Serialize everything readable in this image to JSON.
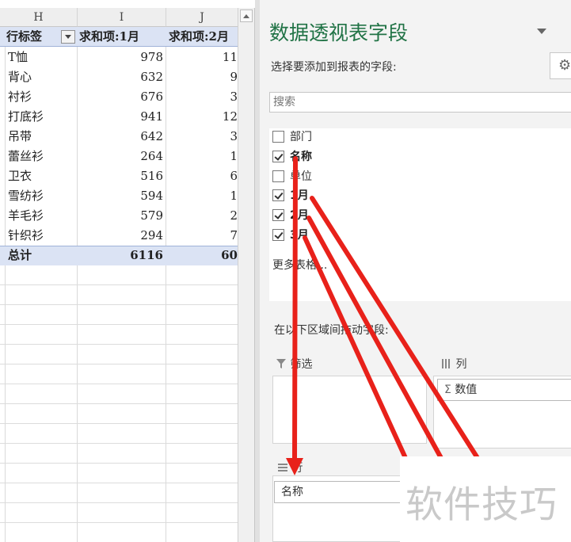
{
  "sheet": {
    "columns": [
      "H",
      "I",
      "J"
    ],
    "header": {
      "row_label": "行标签",
      "col1": "求和项:1月",
      "col2": "求和项:2月"
    },
    "rows": [
      {
        "label": "T恤",
        "v1": "978",
        "v2": "11"
      },
      {
        "label": "背心",
        "v1": "632",
        "v2": "9"
      },
      {
        "label": "衬衫",
        "v1": "676",
        "v2": "3"
      },
      {
        "label": "打底衫",
        "v1": "941",
        "v2": "12"
      },
      {
        "label": "吊带",
        "v1": "642",
        "v2": "3"
      },
      {
        "label": "蕾丝衫",
        "v1": "264",
        "v2": "1"
      },
      {
        "label": "卫衣",
        "v1": "516",
        "v2": "6"
      },
      {
        "label": "雪纺衫",
        "v1": "594",
        "v2": "1"
      },
      {
        "label": "羊毛衫",
        "v1": "579",
        "v2": "2"
      },
      {
        "label": "针织衫",
        "v1": "294",
        "v2": "7"
      }
    ],
    "total": {
      "label": "总计",
      "v1": "6116",
      "v2": "60"
    }
  },
  "pane": {
    "title": "数据透视表字段",
    "subtitle": "选择要添加到报表的字段:",
    "search_placeholder": "搜索",
    "fields": [
      {
        "label": "部门",
        "checked": false,
        "bold": false
      },
      {
        "label": "名称",
        "checked": true,
        "bold": true
      },
      {
        "label": "单位",
        "checked": false,
        "bold": false
      },
      {
        "label": "1月",
        "checked": true,
        "bold": true
      },
      {
        "label": "2月",
        "checked": true,
        "bold": true
      },
      {
        "label": "3月",
        "checked": true,
        "bold": true
      }
    ],
    "more_tables": "更多表格...",
    "drag_hint": "在以下区域间拖动字段:",
    "areas": {
      "filter_label": "筛选",
      "columns_label": "列",
      "columns_chip": "数值",
      "rows_label": "行",
      "rows_chip": "名称"
    }
  },
  "watermark": "软件技巧",
  "colors": {
    "title_green": "#217346",
    "pivot_header_blue": "#dbe3f4",
    "arrow_red": "#e8211a"
  },
  "icons": [
    "filter-icon",
    "columns-icon",
    "rows-icon",
    "sigma-icon",
    "gear-icon",
    "checkbox-icon",
    "dropdown-icon"
  ]
}
